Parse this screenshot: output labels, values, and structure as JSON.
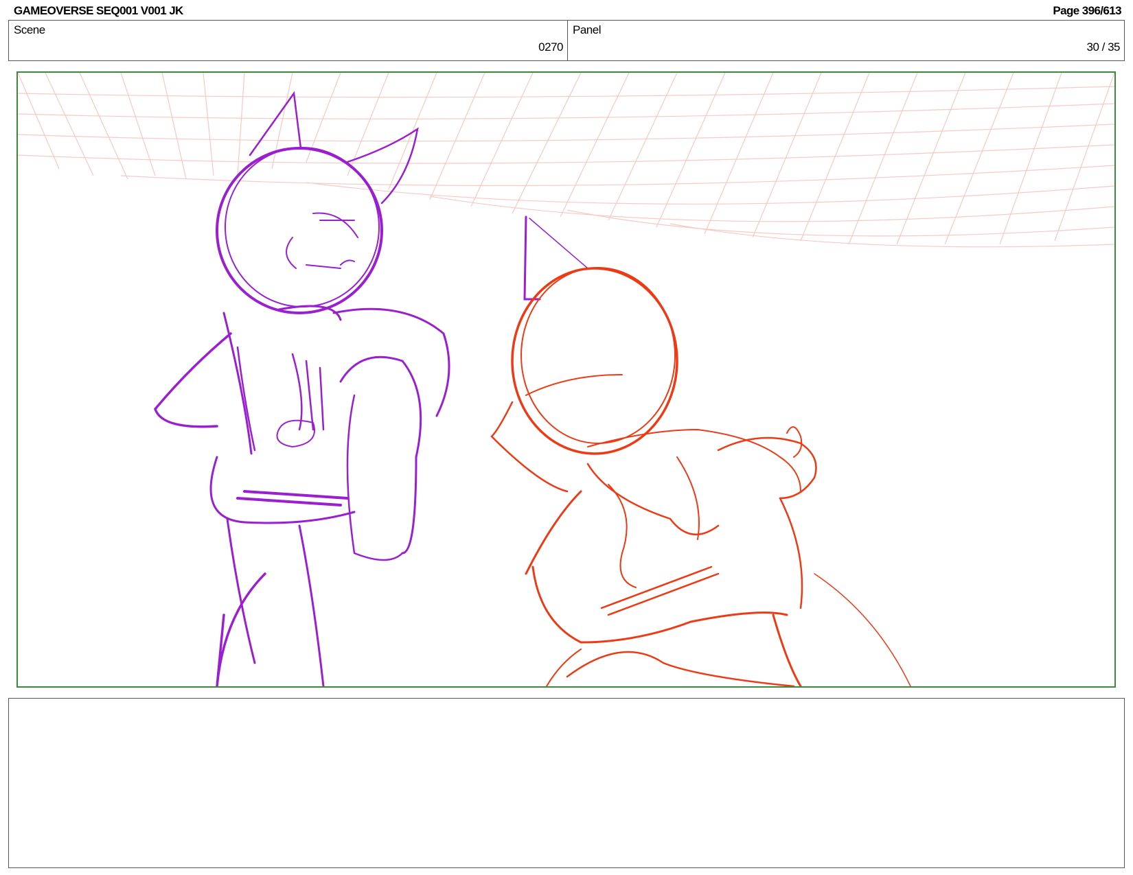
{
  "header": {
    "title": "GAMEOVERSE SEQ001 V001 JK",
    "page": "Page 396/613"
  },
  "info": {
    "scene_label": "Scene",
    "scene_value": "0270",
    "panel_label": "Panel",
    "panel_value": "30 / 35"
  },
  "frame": {
    "border_color": "#3b8a3b",
    "sketch_colors": {
      "left_character": "#9a1fd0",
      "right_character": "#ee3a14",
      "grid": "#f6c4bc"
    }
  },
  "notes": {
    "text": ""
  }
}
